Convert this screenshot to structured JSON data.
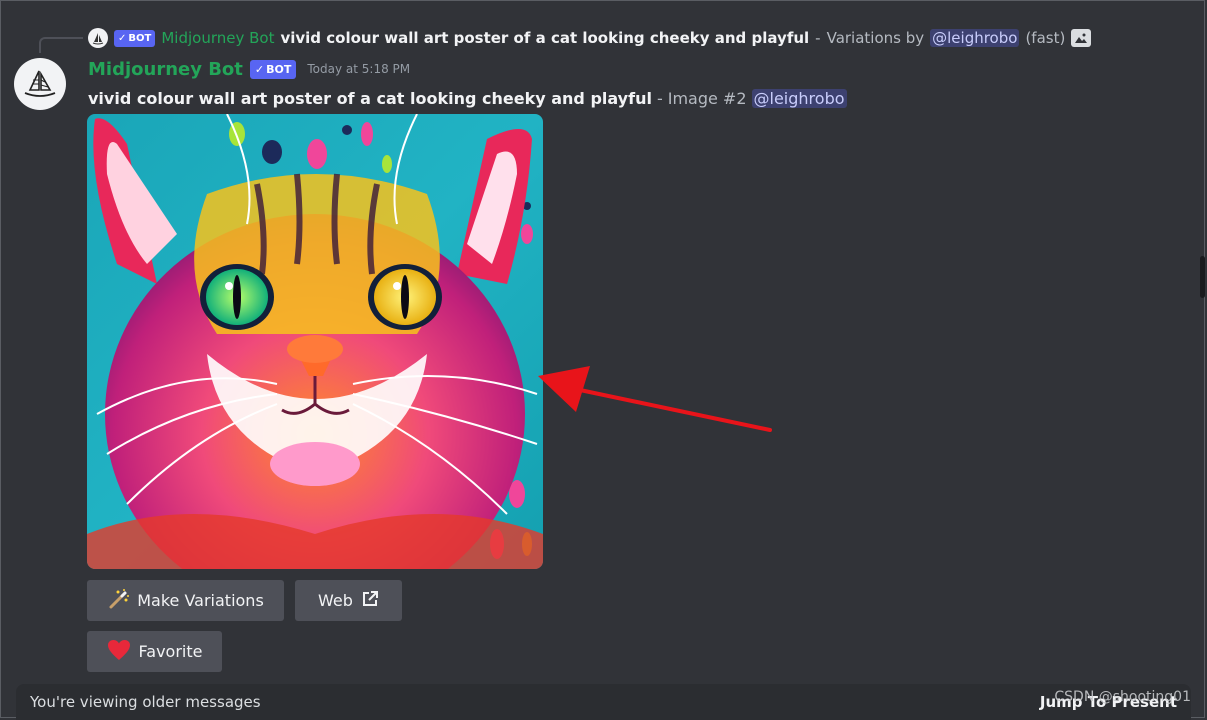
{
  "reply": {
    "bot_tag": "BOT",
    "bot_name": "Midjourney Bot",
    "prompt": "vivid colour wall art poster of a cat looking cheeky and playful",
    "separator": " - ",
    "variations_by": "Variations by",
    "mention": "@leighrobo",
    "mode": "(fast)"
  },
  "message": {
    "author": "Midjourney Bot",
    "bot_tag": "BOT",
    "timestamp": "Today at 5:18 PM",
    "prompt": "vivid colour wall art poster of a cat looking cheeky and playful",
    "separator": " - ",
    "image_label": "Image #2",
    "mention": "@leighrobo"
  },
  "buttons": {
    "make_variations": "Make Variations",
    "web": "Web",
    "favorite": "Favorite"
  },
  "bottom_bar": {
    "older_text": "You're viewing older messages",
    "jump_text": "Jump To Present"
  },
  "watermark": "CSDN @shooting01",
  "colors": {
    "background": "#313338",
    "bot_green": "#23a559",
    "blurple": "#5865f2",
    "arrow_red": "#e8141a"
  }
}
